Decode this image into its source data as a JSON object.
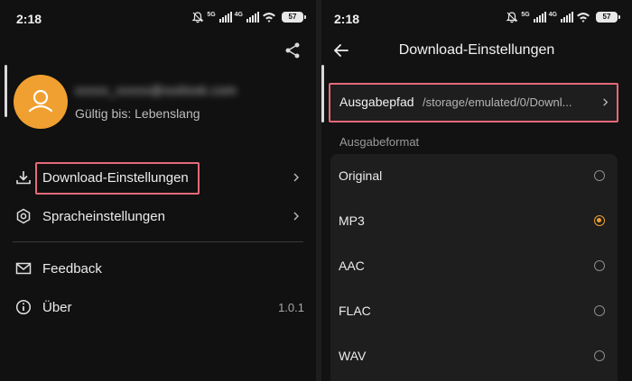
{
  "colors": {
    "accent": "#f0a030",
    "highlight": "#e5697a",
    "background": "#111111"
  },
  "left": {
    "status": {
      "time": "2:18",
      "net1": "5G",
      "net2": "4G",
      "battery": "57"
    },
    "profile": {
      "email": "xxxxx_xxxxx@outlook.com",
      "validity": "Gültig bis: Lebenslang"
    },
    "menu": [
      {
        "label": "Download-Einstellungen",
        "icon": "download-icon"
      },
      {
        "label": "Spracheinstellungen",
        "icon": "settings-icon"
      },
      {
        "label": "Feedback",
        "icon": "mail-icon"
      },
      {
        "label": "Über",
        "icon": "info-icon",
        "value": "1.0.1"
      }
    ]
  },
  "right": {
    "status": {
      "time": "2:18",
      "net1": "5G",
      "net2": "4G",
      "battery": "57"
    },
    "title": "Download-Einstellungen",
    "output_path": {
      "label": "Ausgabepfad",
      "value": "/storage/emulated/0/Downl..."
    },
    "format_section": "Ausgabeformat",
    "formats": [
      {
        "label": "Original",
        "selected": false
      },
      {
        "label": "MP3",
        "selected": true
      },
      {
        "label": "AAC",
        "selected": false
      },
      {
        "label": "FLAC",
        "selected": false
      },
      {
        "label": "WAV",
        "selected": false
      }
    ]
  }
}
